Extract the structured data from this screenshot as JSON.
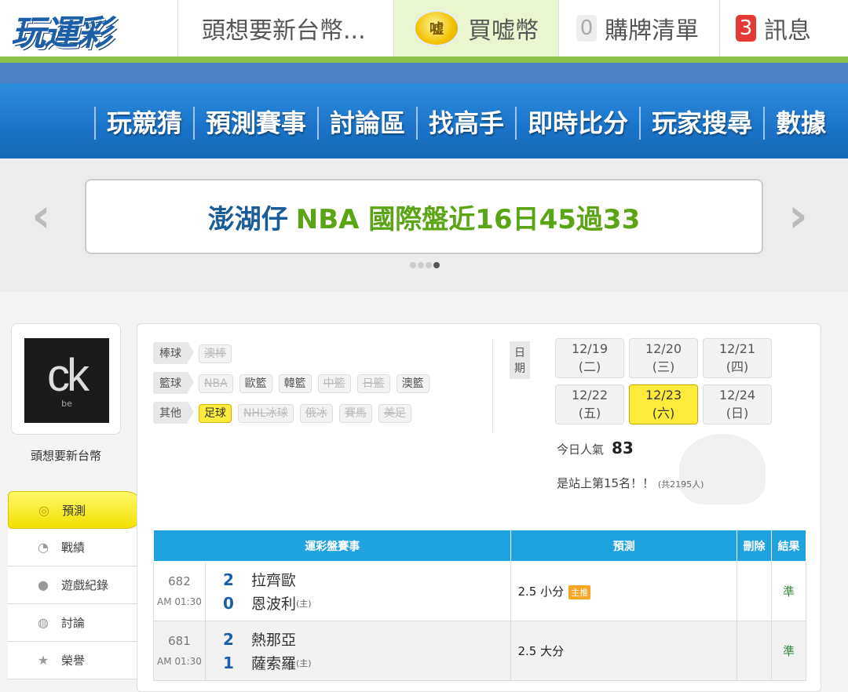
{
  "header": {
    "logo_text": "玩運彩",
    "user_tab": "頭想要新台幣...",
    "coin_label": "嘘",
    "buy_label": "買嘘幣",
    "cart_count": "0",
    "cart_label": "購牌清單",
    "msg_count": "3",
    "msg_label": "訊息"
  },
  "nav": {
    "items": [
      "玩競猜",
      "預測賽事",
      "討論區",
      "找高手",
      "即時比分",
      "玩家搜尋",
      "數據"
    ]
  },
  "banner": {
    "name": "澎湖仔",
    "record": "NBA 國際盤近16日45過33",
    "prev_glyph": "‹",
    "next_glyph": "›"
  },
  "profile": {
    "avatar_text": "ck",
    "avatar_sub": "be",
    "username": "頭想要新台幣"
  },
  "side_menu": [
    {
      "label": "預測",
      "icon": "target-icon",
      "active": true
    },
    {
      "label": "戰績",
      "icon": "record-icon",
      "active": false
    },
    {
      "label": "遊戲紀錄",
      "icon": "circle-icon",
      "active": false
    },
    {
      "label": "討論",
      "icon": "chat-icon",
      "active": false
    },
    {
      "label": "榮譽",
      "icon": "medal-icon",
      "active": false
    }
  ],
  "filters": {
    "baseball": {
      "label": "棒球",
      "chips": [
        {
          "t": "澳棒",
          "s": "off"
        }
      ]
    },
    "basketball": {
      "label": "籃球",
      "chips": [
        {
          "t": "NBA",
          "s": "off"
        },
        {
          "t": "歐籃",
          "s": ""
        },
        {
          "t": "韓籃",
          "s": ""
        },
        {
          "t": "中籃",
          "s": "off"
        },
        {
          "t": "日籃",
          "s": "off"
        },
        {
          "t": "澳籃",
          "s": ""
        }
      ]
    },
    "other": {
      "label": "其他",
      "chips": [
        {
          "t": "足球",
          "s": "sel"
        },
        {
          "t": "NHL冰球",
          "s": "off"
        },
        {
          "t": "俄冰",
          "s": "off"
        },
        {
          "t": "賽馬",
          "s": "off"
        },
        {
          "t": "美足",
          "s": "off"
        }
      ]
    }
  },
  "dates": {
    "label": "日期",
    "items": [
      {
        "t": "12/19 (二)",
        "s": ""
      },
      {
        "t": "12/20 (三)",
        "s": ""
      },
      {
        "t": "12/21 (四)",
        "s": ""
      },
      {
        "t": "12/22 (五)",
        "s": ""
      },
      {
        "t": "12/23 (六)",
        "s": "sel"
      },
      {
        "t": "12/24 (日)",
        "s": ""
      }
    ]
  },
  "stats": {
    "pop_label": "今日人氣",
    "pop_value": "83",
    "rank_text": "是站上第15名！！",
    "rank_total": "(共2195人)"
  },
  "table": {
    "headers": [
      "運彩盤賽事",
      "預測",
      "刪除",
      "結果"
    ],
    "rows": [
      {
        "id": "682",
        "time": "AM 01:30",
        "s1": "2",
        "t1": "拉齊歐",
        "s2": "0",
        "t2": "恩波利",
        "home": "(主)",
        "pred": "2.5 小分",
        "hot": "主推",
        "res": "準"
      },
      {
        "id": "681",
        "time": "AM 01:30",
        "s1": "2",
        "t1": "熱那亞",
        "s2": "1",
        "t2": "薩索羅",
        "home": "(主)",
        "pred": "2.5 大分",
        "hot": "",
        "res": "準"
      }
    ]
  },
  "colors": {
    "brand_blue": "#1a73c9",
    "accent_green": "#8bc34a",
    "highlight_yellow": "#ffeb3b",
    "table_header": "#1ea2e0",
    "result_green": "#2e8b3a"
  }
}
